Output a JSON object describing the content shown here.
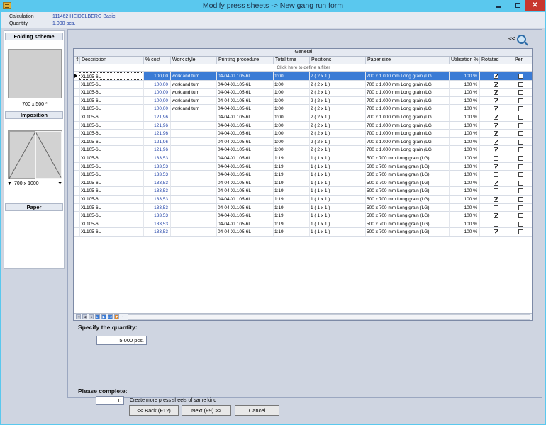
{
  "window": {
    "title": "Modify press sheets -> New gang run form",
    "min": "",
    "max": "",
    "close": "✕"
  },
  "info": {
    "calc_label": "Calculation",
    "calc_value": "111462 HEIDELBERG Basic",
    "qty_label": "Quantity",
    "qty_value": "1.000 pcs."
  },
  "left": {
    "folding_title": "Folding scheme",
    "folding_size": "700 x 500 *",
    "imposition_title": "Imposition",
    "imposition_size": "700 x 1000",
    "paper_title": "Paper"
  },
  "grid": {
    "zoom_label": "<<",
    "band": "General",
    "filter": "Click here to define a filter",
    "headers": [
      "Description",
      "% cost",
      "Work style",
      "Printing procedure",
      "Total time",
      "Positions",
      "Paper size",
      "Utilisation %",
      "Rotated",
      "Per"
    ],
    "rows": [
      {
        "desc": "XL105-6L",
        "cost": "100,00",
        "work": "work and turn",
        "proc": "04-04-XL105-6L",
        "time": "1:00",
        "pos": "2 ( 2 x 1 )",
        "paper": "700 x 1.000 mm Long grain (LG",
        "util": "100 %",
        "rot": true,
        "per": false,
        "selected": true
      },
      {
        "desc": "XL105-6L",
        "cost": "100,00",
        "work": "work and turn",
        "proc": "04-04-XL105-6L",
        "time": "1:00",
        "pos": "2 ( 2 x 1 )",
        "paper": "700 x 1.000 mm Long grain (LG",
        "util": "100 %",
        "rot": true,
        "per": false
      },
      {
        "desc": "XL105-6L",
        "cost": "100,00",
        "work": "work and turn",
        "proc": "04-04-XL105-6L",
        "time": "1:00",
        "pos": "2 ( 2 x 1 )",
        "paper": "700 x 1.000 mm Long grain (LG",
        "util": "100 %",
        "rot": true,
        "per": false
      },
      {
        "desc": "XL105-6L",
        "cost": "100,00",
        "work": "work and turn",
        "proc": "04-04-XL105-6L",
        "time": "1:00",
        "pos": "2 ( 2 x 1 )",
        "paper": "700 x 1.000 mm Long grain (LG",
        "util": "100 %",
        "rot": true,
        "per": false
      },
      {
        "desc": "XL105-6L",
        "cost": "100,00",
        "work": "work and turn",
        "proc": "04-04-XL105-6L",
        "time": "1:00",
        "pos": "2 ( 2 x 1 )",
        "paper": "700 x 1.000 mm Long grain (LG",
        "util": "100 %",
        "rot": true,
        "per": false
      },
      {
        "desc": "XL105-6L",
        "cost": "121,96",
        "work": "",
        "proc": "04-04-XL105-6L",
        "time": "1:00",
        "pos": "2 ( 2 x 1 )",
        "paper": "700 x 1.000 mm Long grain (LG",
        "util": "100 %",
        "rot": true,
        "per": false
      },
      {
        "desc": "XL105-6L",
        "cost": "121,96",
        "work": "",
        "proc": "04-04-XL105-6L",
        "time": "1:00",
        "pos": "2 ( 2 x 1 )",
        "paper": "700 x 1.000 mm Long grain (LG",
        "util": "100 %",
        "rot": true,
        "per": false
      },
      {
        "desc": "XL105-6L",
        "cost": "121,96",
        "work": "",
        "proc": "04-04-XL105-6L",
        "time": "1:00",
        "pos": "2 ( 2 x 1 )",
        "paper": "700 x 1.000 mm Long grain (LG",
        "util": "100 %",
        "rot": true,
        "per": false
      },
      {
        "desc": "XL105-6L",
        "cost": "121,96",
        "work": "",
        "proc": "04-04-XL105-6L",
        "time": "1:00",
        "pos": "2 ( 2 x 1 )",
        "paper": "700 x 1.000 mm Long grain (LG",
        "util": "100 %",
        "rot": true,
        "per": false
      },
      {
        "desc": "XL105-6L",
        "cost": "121,96",
        "work": "",
        "proc": "04-04-XL105-6L",
        "time": "1:00",
        "pos": "2 ( 2 x 1 )",
        "paper": "700 x 1.000 mm Long grain (LG",
        "util": "100 %",
        "rot": true,
        "per": false
      },
      {
        "desc": "XL105-6L",
        "cost": "133,53",
        "work": "",
        "proc": "04-04-XL105-6L",
        "time": "1:19",
        "pos": "1 ( 1 x 1 )",
        "paper": "500 x  700 mm Long grain (LG)",
        "util": "100 %",
        "rot": false,
        "per": false
      },
      {
        "desc": "XL105-6L",
        "cost": "133,53",
        "work": "",
        "proc": "04-04-XL105-6L",
        "time": "1:19",
        "pos": "1 ( 1 x 1 )",
        "paper": "500 x  700 mm Long grain (LG)",
        "util": "100 %",
        "rot": true,
        "per": false
      },
      {
        "desc": "XL105-6L",
        "cost": "133,53",
        "work": "",
        "proc": "04-04-XL105-6L",
        "time": "1:19",
        "pos": "1 ( 1 x 1 )",
        "paper": "500 x  700 mm Long grain (LG)",
        "util": "100 %",
        "rot": false,
        "per": false
      },
      {
        "desc": "XL105-6L",
        "cost": "133,53",
        "work": "",
        "proc": "04-04-XL105-6L",
        "time": "1:19",
        "pos": "1 ( 1 x 1 )",
        "paper": "500 x  700 mm Long grain (LG)",
        "util": "100 %",
        "rot": true,
        "per": false
      },
      {
        "desc": "XL105-6L",
        "cost": "133,53",
        "work": "",
        "proc": "04-04-XL105-6L",
        "time": "1:19",
        "pos": "1 ( 1 x 1 )",
        "paper": "500 x  700 mm Long grain (LG)",
        "util": "100 %",
        "rot": false,
        "per": false
      },
      {
        "desc": "XL105-6L",
        "cost": "133,53",
        "work": "",
        "proc": "04-04-XL105-6L",
        "time": "1:19",
        "pos": "1 ( 1 x 1 )",
        "paper": "500 x  700 mm Long grain (LG)",
        "util": "100 %",
        "rot": true,
        "per": false
      },
      {
        "desc": "XL105-6L",
        "cost": "133,53",
        "work": "",
        "proc": "04-04-XL105-6L",
        "time": "1:19",
        "pos": "1 ( 1 x 1 )",
        "paper": "500 x  700 mm Long grain (LG)",
        "util": "100 %",
        "rot": false,
        "per": false
      },
      {
        "desc": "XL105-6L",
        "cost": "133,53",
        "work": "",
        "proc": "04-04-XL105-6L",
        "time": "1:19",
        "pos": "1 ( 1 x 1 )",
        "paper": "500 x  700 mm Long grain (LG)",
        "util": "100 %",
        "rot": true,
        "per": false
      },
      {
        "desc": "XL105-6L",
        "cost": "133,53",
        "work": "",
        "proc": "04-04-XL105-6L",
        "time": "1:19",
        "pos": "1 ( 1 x 1 )",
        "paper": "500 x  700 mm Long grain (LG)",
        "util": "100 %",
        "rot": false,
        "per": false
      },
      {
        "desc": "XL105-6L",
        "cost": "133,53",
        "work": "",
        "proc": "04-04-XL105-6L",
        "time": "1:19",
        "pos": "1 ( 1 x 1 )",
        "paper": "500 x  700 mm Long grain (LG)",
        "util": "100 %",
        "rot": true,
        "per": false
      }
    ]
  },
  "quantity": {
    "label": "Specify the quantity:",
    "value": "5.000 pcs."
  },
  "complete": {
    "label": "Please complete:",
    "value": "0",
    "hint": "Create more press sheets of same kind"
  },
  "buttons": {
    "back": "<< Back (F12)",
    "next": "Next (F9) >>",
    "cancel": "Cancel"
  }
}
